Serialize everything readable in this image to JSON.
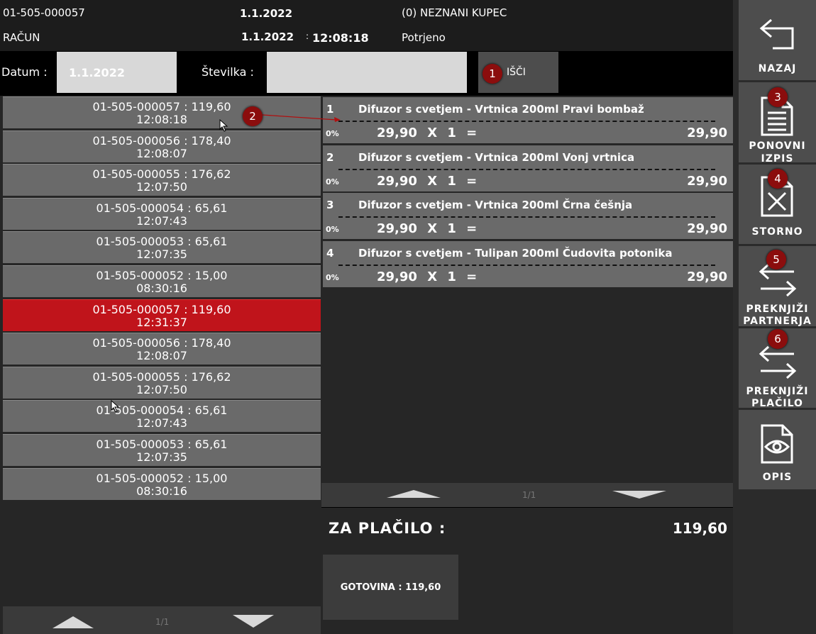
{
  "header": {
    "doc_number": "01-505-000057",
    "doc_date": "1.1.2022",
    "customer": "(0) NEZNANI KUPEC",
    "doc_type": "RAČUN",
    "issue_date": "1.1.2022",
    "time_sep": ":",
    "time": "12:08:18",
    "status": "Potrjeno"
  },
  "search": {
    "date_label": "Datum :",
    "date_value": "1.1.2022",
    "number_label": "Številka :",
    "number_value": "",
    "search_button": "IŠČI"
  },
  "receipts": [
    {
      "line": "01-505-000057 :  119,60",
      "time": "12:08:18"
    },
    {
      "line": "01-505-000056 :  178,40",
      "time": "12:08:07"
    },
    {
      "line": "01-505-000055 :  176,62",
      "time": "12:07:50"
    },
    {
      "line": "01-505-000054 :  65,61",
      "time": "12:07:43"
    },
    {
      "line": "01-505-000053 :  65,61",
      "time": "12:07:35"
    },
    {
      "line": "01-505-000052 :  15,00",
      "time": "08:30:16"
    },
    {
      "line": "01-505-000057 :  119,60",
      "time": "12:31:37"
    },
    {
      "line": "01-505-000056 :  178,40",
      "time": "12:08:07"
    },
    {
      "line": "01-505-000055 :  176,62",
      "time": "12:07:50"
    },
    {
      "line": "01-505-000054 :  65,61",
      "time": "12:07:43"
    },
    {
      "line": "01-505-000053 :  65,61",
      "time": "12:07:35"
    },
    {
      "line": "01-505-000052 :  15,00",
      "time": "08:30:16"
    }
  ],
  "selected_receipt_index": 6,
  "list_page": "1/1",
  "items": [
    {
      "num": "1",
      "name": "Difuzor s cvetjem - Vrtnica 200ml Pravi bombaž",
      "tax": "0%",
      "calc": "29,90 X 1 =",
      "total": "29,90"
    },
    {
      "num": "2",
      "name": "Difuzor s cvetjem - Vrtnica 200ml Vonj vrtnica",
      "tax": "0%",
      "calc": "29,90 X 1 =",
      "total": "29,90"
    },
    {
      "num": "3",
      "name": "Difuzor s cvetjem - Vrtnica 200ml Črna češnja",
      "tax": "0%",
      "calc": "29,90 X 1 =",
      "total": "29,90"
    },
    {
      "num": "4",
      "name": "Difuzor s cvetjem - Tulipan 200ml Čudovita potonika",
      "tax": "0%",
      "calc": "29,90 X 1 =",
      "total": "29,90"
    }
  ],
  "items_page": "1/1",
  "payment": {
    "label": "ZA PLAČILO :",
    "amount": "119,60",
    "cash": "GOTOVINA : 119,60"
  },
  "side_buttons": {
    "back": {
      "line1": "NAZAJ",
      "icon": "back-arrow-icon"
    },
    "reprint": {
      "line1": "PONOVNI",
      "line2": "IZPIS",
      "icon": "document-icon"
    },
    "storno": {
      "line1": "STORNO",
      "icon": "document-x-icon"
    },
    "rebook_partner": {
      "line1": "PREKNJIŽI",
      "line2": "PARTNERJA",
      "icon": "swap-arrows-icon"
    },
    "rebook_payment": {
      "line1": "PREKNJIŽI",
      "line2": "PLAČILO",
      "icon": "swap-arrows-icon"
    },
    "description": {
      "line1": "OPIS",
      "icon": "document-eye-icon"
    }
  },
  "badges": [
    "1",
    "2",
    "3",
    "4",
    "5",
    "6"
  ],
  "colors": {
    "accent": "#c0141b",
    "badge": "#8b0d0d",
    "button": "#4d4d4d",
    "row": "#6a6a6a"
  }
}
